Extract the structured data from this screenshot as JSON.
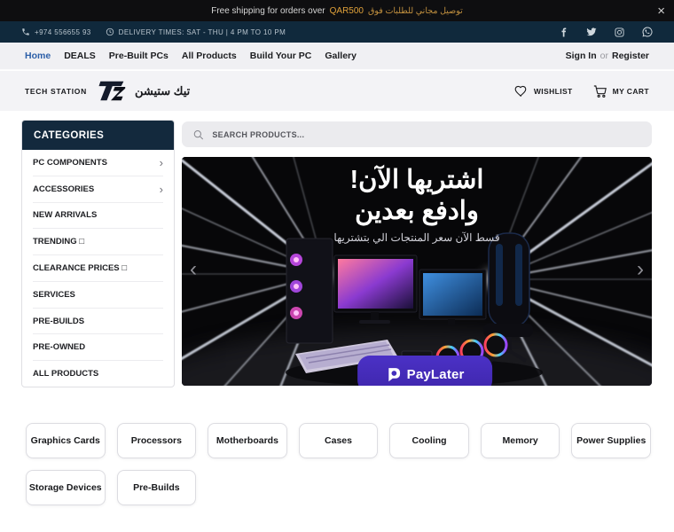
{
  "announcement": {
    "text": "Free shipping for orders over",
    "highlight": "QAR500",
    "text_ar": "توصيل مجاني للطلبات فوق",
    "close": "×"
  },
  "infobar": {
    "phone": "+974 556655 93",
    "delivery": "DELIVERY TIMES: SAT - THU | 4 PM TO 10 PM",
    "social": [
      "facebook",
      "twitter",
      "instagram",
      "whatsapp"
    ]
  },
  "nav": {
    "items": [
      {
        "label": "Home"
      },
      {
        "label": "DEALS"
      },
      {
        "label": "Pre-Built PCs"
      },
      {
        "label": "All Products"
      },
      {
        "label": "Build Your PC"
      },
      {
        "label": "Gallery"
      }
    ],
    "sign_in": "Sign In",
    "or": "or",
    "register": "Register"
  },
  "header": {
    "brand_en": "TECH STATION",
    "brand_ar": "تيك ستيشن",
    "wishlist": "WISHLIST",
    "cart": "MY CART"
  },
  "sidebar": {
    "title": "CATEGORIES",
    "items": [
      {
        "label": "PC COMPONENTS",
        "chevron": "›"
      },
      {
        "label": "ACCESSORIES",
        "chevron": "›"
      },
      {
        "label": "NEW ARRIVALS",
        "chevron": ""
      },
      {
        "label": "TRENDING □",
        "chevron": ""
      },
      {
        "label": "CLEARANCE PRICES □",
        "chevron": ""
      },
      {
        "label": "SERVICES",
        "chevron": ""
      },
      {
        "label": "PRE-BUILDS",
        "chevron": ""
      },
      {
        "label": "PRE-OWNED",
        "chevron": ""
      },
      {
        "label": "ALL PRODUCTS",
        "chevron": ""
      }
    ]
  },
  "search": {
    "placeholder": "SEARCH PRODUCTS..."
  },
  "banner": {
    "headline1": "اشتريها الآن!",
    "headline2": "وادفع بعدين",
    "subtitle": "قسط الآن سعر المنتجات الي بتشتريها",
    "paylater": "PayLater",
    "prev": "‹",
    "next": "›"
  },
  "quicklinks": [
    "Graphics Cards",
    "Processors",
    "Motherboards",
    "Cases",
    "Cooling",
    "Memory",
    "Power Supplies",
    "Storage Devices",
    "Pre-Builds"
  ],
  "colors": {
    "navy": "#11293d",
    "amber": "#e1a23a",
    "link_blue": "#2c5fa8",
    "paylater_purple": "#4430bd"
  }
}
